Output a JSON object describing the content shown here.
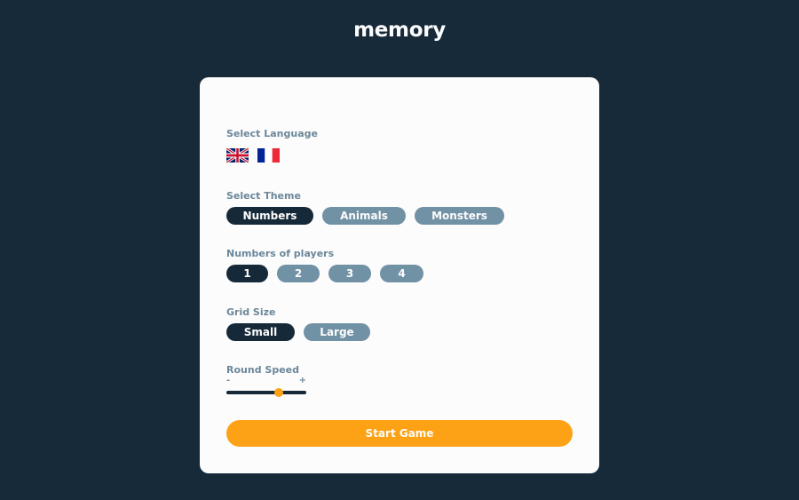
{
  "app": {
    "title": "memory"
  },
  "settings": {
    "language": {
      "label": "Select Language",
      "options": [
        {
          "icon": "uk-flag-icon",
          "selected": true
        },
        {
          "icon": "france-flag-icon",
          "selected": false
        }
      ]
    },
    "theme": {
      "label": "Select Theme",
      "options": [
        "Numbers",
        "Animals",
        "Monsters"
      ],
      "selected": "Numbers"
    },
    "players": {
      "label": "Numbers of players",
      "options": [
        "1",
        "2",
        "3",
        "4"
      ],
      "selected": "1"
    },
    "grid": {
      "label": "Grid Size",
      "options": [
        "Small",
        "Large"
      ],
      "selected": "Small"
    },
    "speed": {
      "label": "Round Speed",
      "min_label": "-",
      "max_label": "+",
      "value": 0.65
    }
  },
  "actions": {
    "start_label": "Start Game"
  },
  "colors": {
    "background": "#172a3a",
    "card": "#fcfcfc",
    "active": "#152938",
    "inactive": "#7191a5",
    "accent": "#fda214",
    "label": "#6b8799"
  }
}
